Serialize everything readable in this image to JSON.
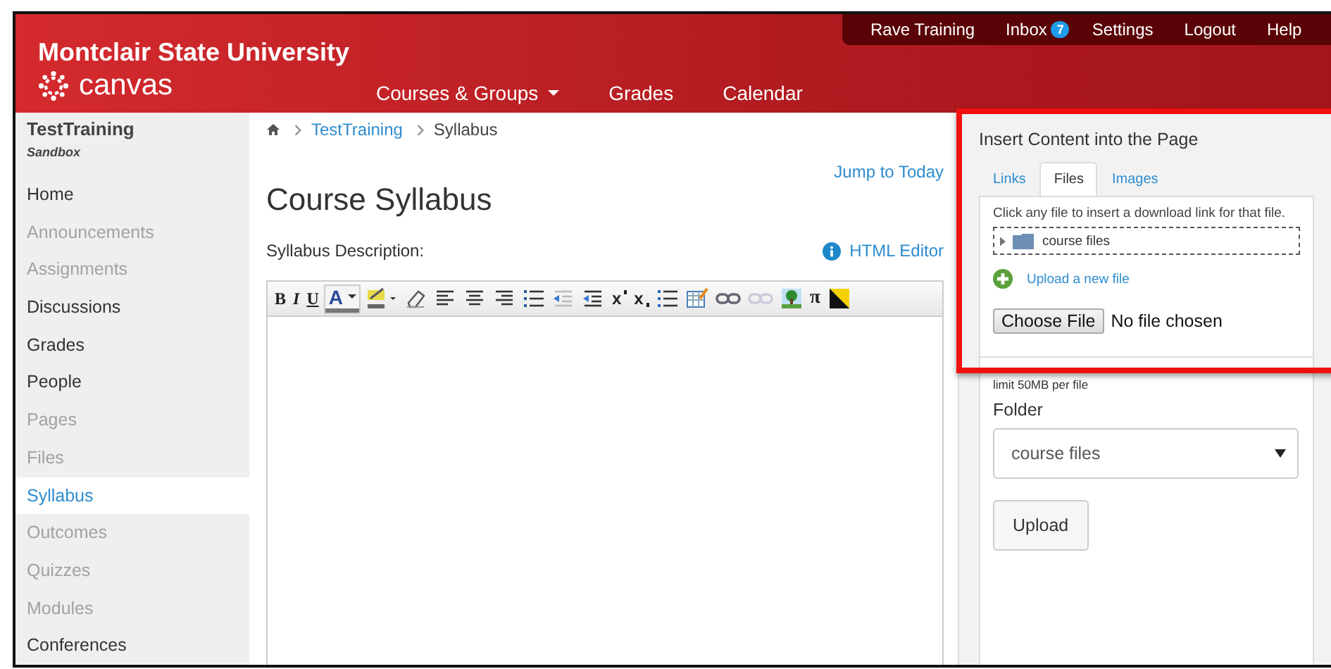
{
  "header": {
    "institution": "Montclair State University",
    "logo_text": "canvas",
    "nav": [
      {
        "label": "Courses & Groups",
        "dropdown": true
      },
      {
        "label": "Grades",
        "dropdown": false
      },
      {
        "label": "Calendar",
        "dropdown": false
      }
    ],
    "user_menu": [
      {
        "label": "Rave Training"
      },
      {
        "label": "Inbox",
        "badge": "7"
      },
      {
        "label": "Settings"
      },
      {
        "label": "Logout"
      },
      {
        "label": "Help"
      }
    ]
  },
  "sidebar": {
    "course": "TestTraining",
    "subtitle": "Sandbox",
    "items": [
      {
        "label": "Home",
        "disabled": false,
        "selected": false
      },
      {
        "label": "Announcements",
        "disabled": true,
        "selected": false
      },
      {
        "label": "Assignments",
        "disabled": true,
        "selected": false
      },
      {
        "label": "Discussions",
        "disabled": false,
        "selected": false
      },
      {
        "label": "Grades",
        "disabled": false,
        "selected": false
      },
      {
        "label": "People",
        "disabled": false,
        "selected": false
      },
      {
        "label": "Pages",
        "disabled": true,
        "selected": false
      },
      {
        "label": "Files",
        "disabled": true,
        "selected": false
      },
      {
        "label": "Syllabus",
        "disabled": false,
        "selected": true
      },
      {
        "label": "Outcomes",
        "disabled": true,
        "selected": false
      },
      {
        "label": "Quizzes",
        "disabled": true,
        "selected": false
      },
      {
        "label": "Modules",
        "disabled": true,
        "selected": false
      },
      {
        "label": "Conferences",
        "disabled": false,
        "selected": false
      }
    ]
  },
  "breadcrumb": [
    {
      "label": "TestTraining",
      "link": true
    },
    {
      "label": "Syllabus",
      "link": false
    }
  ],
  "jump_link": "Jump to Today",
  "page_title": "Course Syllabus",
  "description_label": "Syllabus Description:",
  "html_editor_link": "HTML Editor",
  "toolbar": [
    {
      "kind": "bold",
      "label": "B"
    },
    {
      "kind": "italic",
      "label": "I"
    },
    {
      "kind": "underline",
      "label": "U"
    },
    {
      "kind": "color",
      "label": "A"
    },
    {
      "kind": "highlight"
    },
    {
      "kind": "eraser"
    },
    {
      "kind": "alignleft"
    },
    {
      "kind": "aligncenter"
    },
    {
      "kind": "alignright"
    },
    {
      "kind": "bullets"
    },
    {
      "kind": "outdent"
    },
    {
      "kind": "indent"
    },
    {
      "kind": "sup",
      "label": "x"
    },
    {
      "kind": "sub",
      "label": "x"
    },
    {
      "kind": "numbers"
    },
    {
      "kind": "table"
    },
    {
      "kind": "link"
    },
    {
      "kind": "unlink"
    },
    {
      "kind": "image"
    },
    {
      "kind": "pi",
      "label": "π"
    },
    {
      "kind": "media"
    }
  ],
  "panel": {
    "title": "Insert Content into the Page",
    "tabs": [
      {
        "label": "Links",
        "selected": false
      },
      {
        "label": "Files",
        "selected": true
      },
      {
        "label": "Images",
        "selected": false
      }
    ],
    "hint": "Click any file to insert a download link for that file.",
    "folder_node": "course files",
    "upload_link": "Upload a new file",
    "choose_button": "Choose File",
    "no_file": "No file chosen",
    "limit": "limit 50MB per file",
    "folder_label": "Folder",
    "folder_value": "course files",
    "upload_button": "Upload"
  }
}
